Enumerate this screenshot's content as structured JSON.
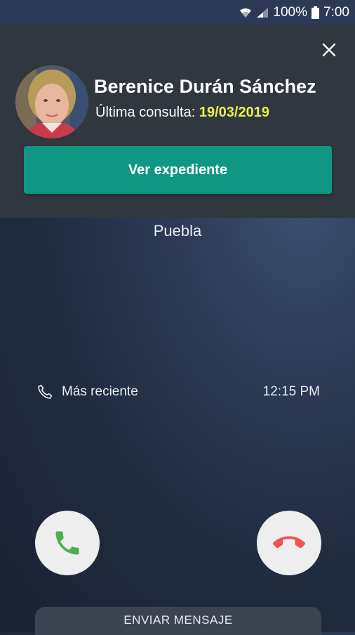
{
  "status_bar": {
    "battery": "100%",
    "time": "7:00"
  },
  "caller_card": {
    "name": "Berenice Durán Sánchez",
    "last_consult_label": "Última consulta:",
    "last_consult_date": "19/03/2019",
    "view_record_button": "Ver expediente"
  },
  "call": {
    "location": "Puebla",
    "recent_label": "Más reciente",
    "recent_time": "12:15 PM",
    "send_message": "ENVIAR MENSAJE"
  },
  "colors": {
    "accent_button": "#109784",
    "date_highlight": "#ecef52",
    "accept_icon": "#4caf50",
    "decline_icon": "#ef5350"
  }
}
